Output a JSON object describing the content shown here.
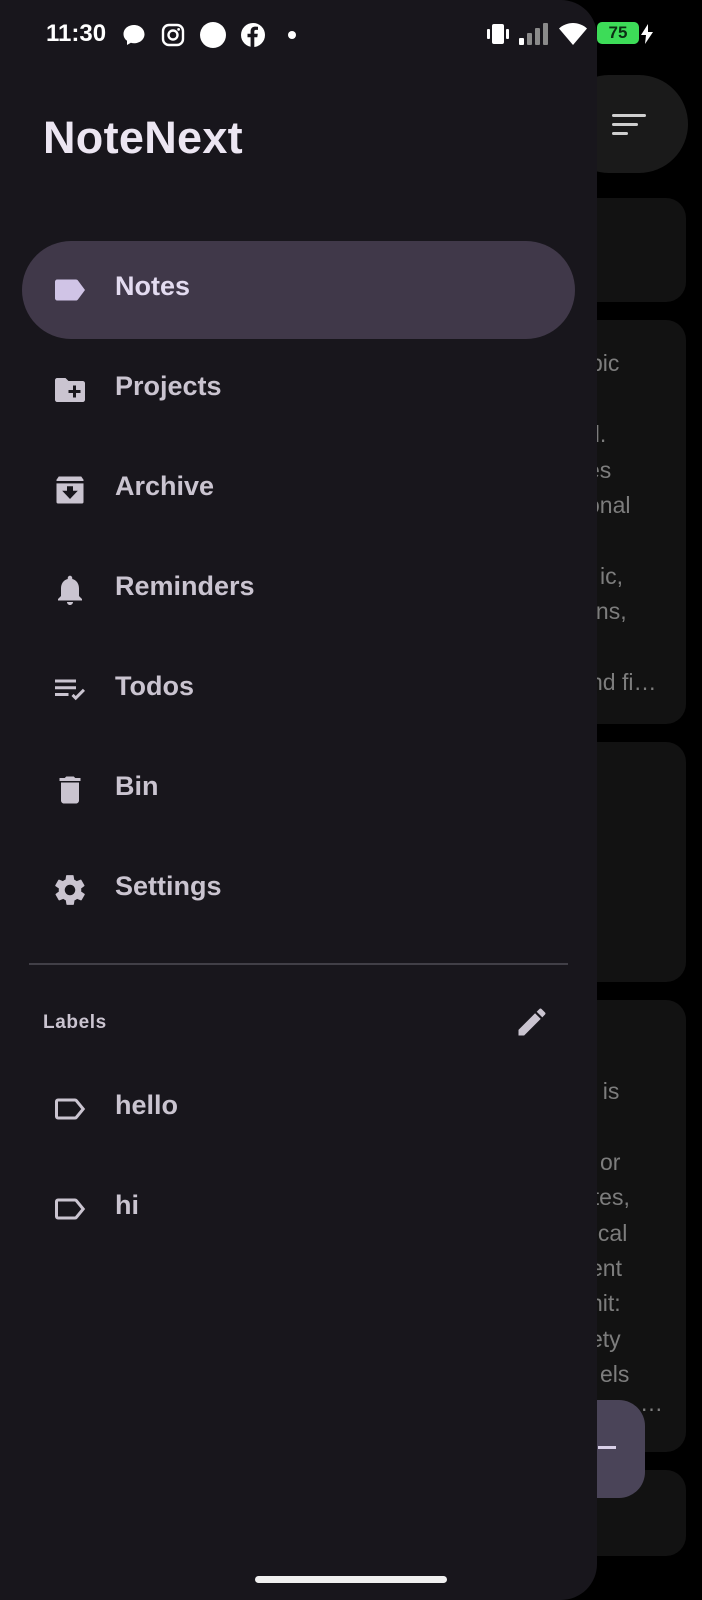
{
  "status_bar": {
    "time": "11:30",
    "battery": "75"
  },
  "app": {
    "title": "NoteNext"
  },
  "nav": {
    "items": [
      {
        "label": "Notes",
        "icon": "label-icon",
        "active": true
      },
      {
        "label": "Projects",
        "icon": "folder-add-icon",
        "active": false
      },
      {
        "label": "Archive",
        "icon": "archive-icon",
        "active": false
      },
      {
        "label": "Reminders",
        "icon": "bell-icon",
        "active": false
      },
      {
        "label": "Todos",
        "icon": "checklist-icon",
        "active": false
      },
      {
        "label": "Bin",
        "icon": "trash-icon",
        "active": false
      },
      {
        "label": "Settings",
        "icon": "gear-icon",
        "active": false
      }
    ]
  },
  "labels": {
    "heading": "Labels",
    "items": [
      {
        "label": "hello"
      },
      {
        "label": "hi"
      }
    ]
  },
  "background_notes": {
    "card2": [
      "pic",
      "el.",
      "es",
      "onal",
      "ic,",
      "ions,",
      "nd fi…"
    ],
    "card4": [
      "t is",
      "or",
      "otes,",
      "nical",
      "ent",
      "nit:",
      "ety",
      "els",
      "…"
    ]
  },
  "colors": {
    "drawer_bg": "#18161c",
    "active_item": "#403849",
    "accent_text": "#e3dbf0",
    "muted_text": "#cac4d0"
  }
}
